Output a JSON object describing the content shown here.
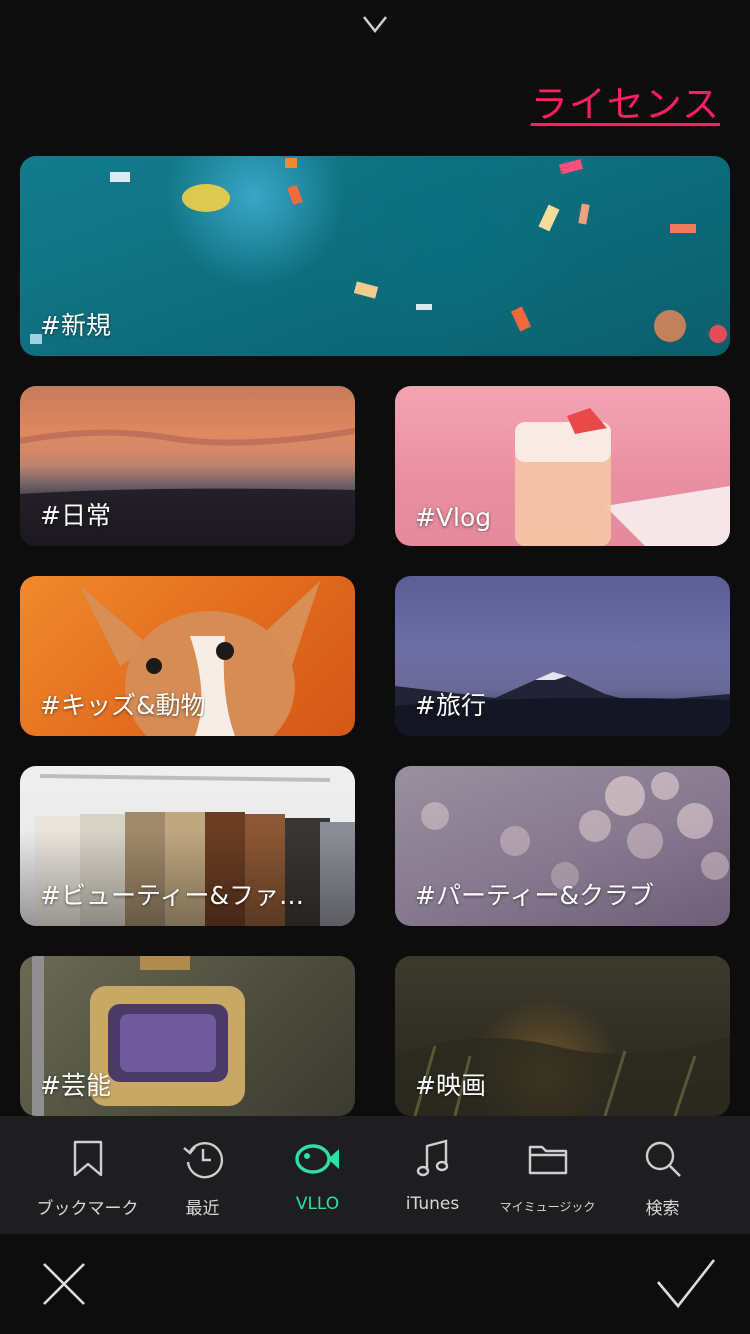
{
  "license_label": "ライセンス",
  "categories": [
    {
      "label": "#新規"
    },
    {
      "label": "#日常"
    },
    {
      "label": "#Vlog"
    },
    {
      "label": "#キッズ&動物"
    },
    {
      "label": "#旅行"
    },
    {
      "label": "#ビューティー&ファ…"
    },
    {
      "label": "#パーティー&クラブ"
    },
    {
      "label": "#芸能"
    },
    {
      "label": "#映画"
    }
  ],
  "tabs": [
    {
      "label": "ブックマーク",
      "icon": "bookmark-icon"
    },
    {
      "label": "最近",
      "icon": "history-icon"
    },
    {
      "label": "VLLO",
      "icon": "fish-icon"
    },
    {
      "label": "iTunes",
      "icon": "music-note-icon"
    },
    {
      "label": "マイミュージック",
      "icon": "folder-icon"
    },
    {
      "label": "検索",
      "icon": "search-icon"
    }
  ],
  "active_tab": "VLLO",
  "colors": {
    "accent": "#2ee0a5",
    "license": "#ff1f63",
    "background": "#0d0d0e"
  }
}
